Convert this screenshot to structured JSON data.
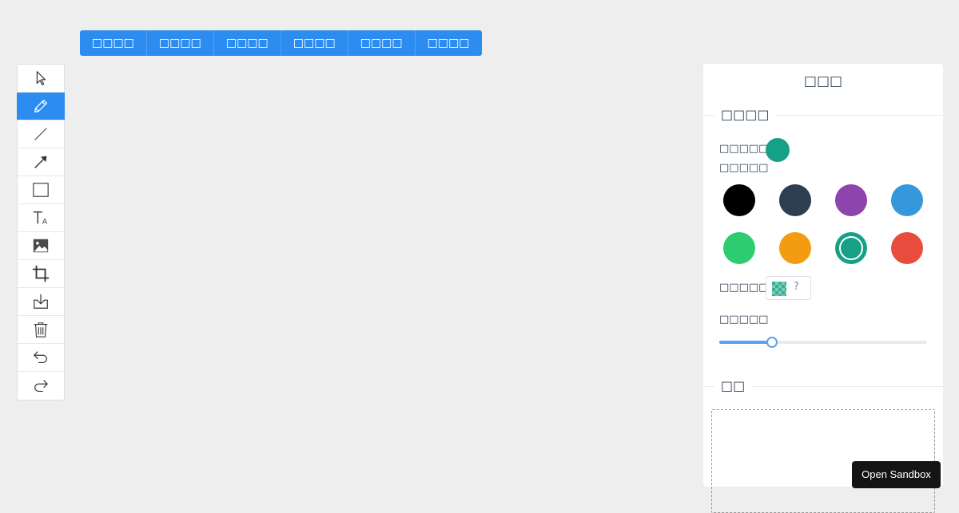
{
  "menu": {
    "items": [
      "□□□□",
      "□□□□",
      "□□□□",
      "□□□□",
      "□□□□",
      "□□□□"
    ]
  },
  "toolbar": {
    "tools": [
      {
        "icon": "pointer-icon",
        "active": false
      },
      {
        "icon": "pencil-icon",
        "active": true
      },
      {
        "icon": "line-icon",
        "active": false
      },
      {
        "icon": "arrow-icon",
        "active": false
      },
      {
        "icon": "rectangle-icon",
        "active": false
      },
      {
        "icon": "text-icon",
        "active": false
      },
      {
        "icon": "image-icon",
        "active": false
      },
      {
        "icon": "crop-icon",
        "active": false
      },
      {
        "icon": "download-icon",
        "active": false
      },
      {
        "icon": "trash-icon",
        "active": false
      },
      {
        "icon": "undo-icon",
        "active": false
      },
      {
        "icon": "redo-icon",
        "active": false
      }
    ],
    "accent": "#2d8cf0"
  },
  "panel": {
    "title": "□□□",
    "section_color_title": "□□□□",
    "current_color_label": "□□□□□",
    "current_color": "#16a085",
    "preset_label": "□□□□□",
    "swatches": [
      "#000000",
      "#2c3e50",
      "#8e44ad",
      "#3498db",
      "#2ecc71",
      "#f39c12",
      "#16a085",
      "#e74c3c"
    ],
    "selected_swatch": "#16a085",
    "custom_label": "□□□□□□",
    "custom_arrow": "?",
    "width_label": "□□□□□",
    "width_fraction": 0.25,
    "section_layer_title": "□□"
  },
  "sandbox_button": "Open Sandbox"
}
